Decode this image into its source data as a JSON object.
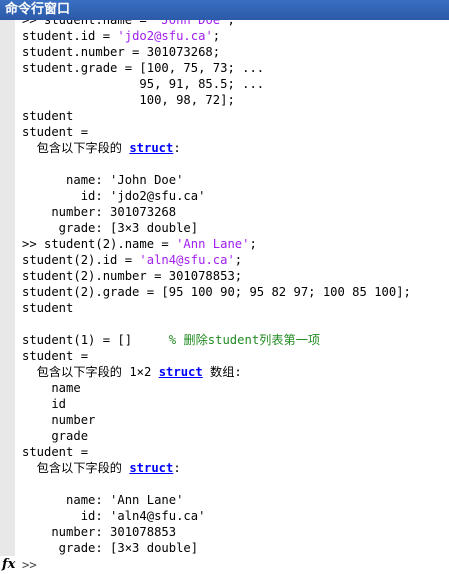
{
  "window": {
    "title": "命令行窗口"
  },
  "lines": [
    {
      "parts": [
        {
          "t": ">> student.name = "
        },
        {
          "t": "'John Doe'",
          "c": "str"
        },
        {
          "t": ";"
        }
      ]
    },
    {
      "parts": [
        {
          "t": "student.id = "
        },
        {
          "t": "'jdo2@sfu.ca'",
          "c": "str"
        },
        {
          "t": ";"
        }
      ]
    },
    {
      "parts": [
        {
          "t": "student.number = 301073268;"
        }
      ]
    },
    {
      "parts": [
        {
          "t": "student.grade = [100, 75, 73; ..."
        }
      ]
    },
    {
      "parts": [
        {
          "t": "                95, 91, 85.5; ..."
        }
      ]
    },
    {
      "parts": [
        {
          "t": "                100, 98, 72];"
        }
      ]
    },
    {
      "parts": [
        {
          "t": "student"
        }
      ]
    },
    {
      "parts": [
        {
          "t": "student ="
        }
      ]
    },
    {
      "parts": [
        {
          "t": "  包含以下字段的 "
        },
        {
          "t": "struct",
          "c": "kw"
        },
        {
          "t": ":"
        }
      ]
    },
    {
      "parts": [
        {
          "t": ""
        }
      ]
    },
    {
      "parts": [
        {
          "t": "      name: 'John Doe'"
        }
      ]
    },
    {
      "parts": [
        {
          "t": "        id: 'jdo2@sfu.ca'"
        }
      ]
    },
    {
      "parts": [
        {
          "t": "    number: 301073268"
        }
      ]
    },
    {
      "parts": [
        {
          "t": "     grade: [3×3 double]"
        }
      ]
    },
    {
      "parts": [
        {
          "t": ">> student(2).name = "
        },
        {
          "t": "'Ann Lane'",
          "c": "str"
        },
        {
          "t": ";"
        }
      ]
    },
    {
      "parts": [
        {
          "t": "student(2).id = "
        },
        {
          "t": "'aln4@sfu.ca'",
          "c": "str"
        },
        {
          "t": ";"
        }
      ]
    },
    {
      "parts": [
        {
          "t": "student(2).number = 301078853;"
        }
      ]
    },
    {
      "parts": [
        {
          "t": "student(2).grade = [95 100 90; 95 82 97; 100 85 100];"
        }
      ]
    },
    {
      "parts": [
        {
          "t": "student"
        }
      ]
    },
    {
      "parts": [
        {
          "t": ""
        }
      ]
    },
    {
      "parts": [
        {
          "t": "student(1) = []     "
        },
        {
          "t": "% 删除student列表第一项",
          "c": "cmt"
        }
      ]
    },
    {
      "parts": [
        {
          "t": "student ="
        }
      ]
    },
    {
      "parts": [
        {
          "t": "  包含以下字段的 1×2 "
        },
        {
          "t": "struct",
          "c": "kw"
        },
        {
          "t": " 数组:"
        }
      ]
    },
    {
      "parts": [
        {
          "t": "    name"
        }
      ]
    },
    {
      "parts": [
        {
          "t": "    id"
        }
      ]
    },
    {
      "parts": [
        {
          "t": "    number"
        }
      ]
    },
    {
      "parts": [
        {
          "t": "    grade"
        }
      ]
    },
    {
      "parts": [
        {
          "t": "student ="
        }
      ]
    },
    {
      "parts": [
        {
          "t": "  包含以下字段的 "
        },
        {
          "t": "struct",
          "c": "kw"
        },
        {
          "t": ":"
        }
      ]
    },
    {
      "parts": [
        {
          "t": ""
        }
      ]
    },
    {
      "parts": [
        {
          "t": "      name: 'Ann Lane'"
        }
      ]
    },
    {
      "parts": [
        {
          "t": "        id: 'aln4@sfu.ca'"
        }
      ]
    },
    {
      "parts": [
        {
          "t": "    number: 301078853"
        }
      ]
    },
    {
      "parts": [
        {
          "t": "     grade: [3×3 double]"
        }
      ]
    }
  ],
  "prompt": {
    "fx_symbol": "fx",
    "text": ">>"
  },
  "colors": {
    "string": "#a020f0",
    "comment": "#228b22",
    "keyword": "#0000ff",
    "title_bg": "#2b5aa8"
  }
}
